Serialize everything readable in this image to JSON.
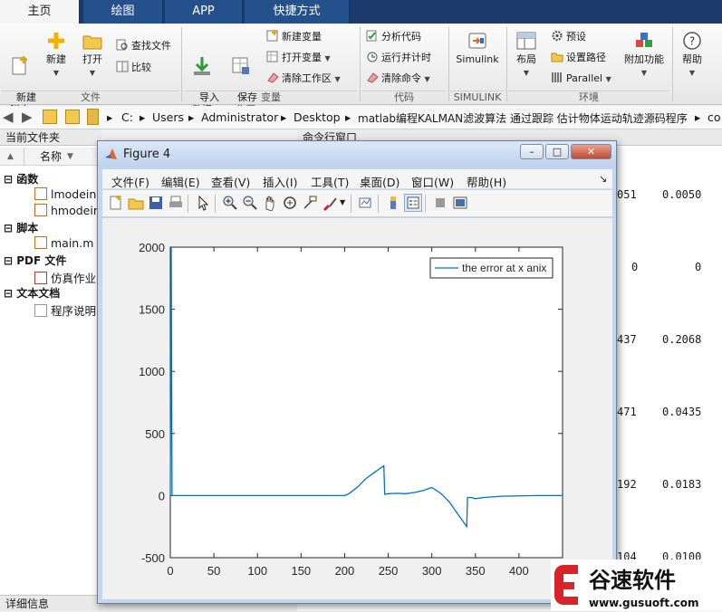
{
  "tabs": [
    "主页",
    "绘图",
    "APP",
    "快捷方式"
  ],
  "ribbon": {
    "new_script": "新建\n脚本",
    "new": "新建",
    "open": "打开",
    "find_files": "查找文件",
    "compare": "比较",
    "import_data": "导入\n数据",
    "save_workspace": "保存\n工作区",
    "new_variable": "新建变量",
    "open_variable": "打开变量",
    "clear_workspace": "清除工作区",
    "analyze_code": "分析代码",
    "run_and_time": "运行并计时",
    "clear_commands": "清除命令",
    "simulink": "Simulink",
    "layout": "布局",
    "preferences": "预设",
    "set_path": "设置路径",
    "parallel": "Parallel",
    "addons": "附加功能",
    "help": "帮助",
    "groups": {
      "file": "文件",
      "variable": "变量",
      "code": "代码",
      "simulink": "SIMULINK",
      "environment": "环境"
    }
  },
  "address": {
    "sep": "▸",
    "parts": [
      "C:",
      "Users",
      "Administrator",
      "Desktop",
      "matlab编程KALMAN滤波算法 通过跟踪 估计物体运动轨迹源码程序",
      "co"
    ]
  },
  "left_panel": {
    "title": "当前文件夹",
    "column_name": "名称",
    "sections": {
      "functions": "函数",
      "scripts": "脚本",
      "pdf": "PDF 文件",
      "text": "文本文档"
    },
    "files": {
      "func1": "lmodeini",
      "func2": "hmodeini",
      "script1": "main.m",
      "pdf1": "仿真作业",
      "text1": "程序说明"
    },
    "details": "详细信息"
  },
  "command_window": {
    "title": "命令行窗口",
    "lines": [
      {
        "a": "051",
        "b": "0.0050"
      },
      {
        "a": "0",
        "b": "0"
      },
      {
        "a": "437",
        "b": "0.2068"
      },
      {
        "a": "471",
        "b": "0.0435"
      },
      {
        "a": "192",
        "b": "0.0183"
      },
      {
        "a": "104",
        "b": "0.0100"
      }
    ]
  },
  "figure": {
    "title": "Figure 4",
    "menu": [
      "文件(F)",
      "编辑(E)",
      "查看(V)",
      "插入(I)",
      "工具(T)",
      "桌面(D)",
      "窗口(W)",
      "帮助(H)"
    ],
    "menu_arrow": "↘",
    "window_buttons": {
      "minimize": "–",
      "maximize": "□",
      "close": "✕"
    }
  },
  "chart_data": {
    "type": "line",
    "title": "",
    "xlabel": "",
    "ylabel": "",
    "xlim": [
      0,
      450
    ],
    "ylim": [
      -500,
      2000
    ],
    "xticks": [
      0,
      50,
      100,
      150,
      200,
      250,
      300,
      350,
      400
    ],
    "yticks": [
      -500,
      0,
      500,
      1000,
      1500,
      2000
    ],
    "grid": false,
    "legend_position": "top-right",
    "color": "#0072bd",
    "series": [
      {
        "name": "the error at x anix",
        "x": [
          0,
          1,
          2,
          3,
          4,
          10,
          50,
          100,
          150,
          200,
          205,
          215,
          225,
          235,
          245,
          246,
          250,
          260,
          270,
          280,
          290,
          300,
          310,
          320,
          330,
          340,
          341,
          345,
          350,
          360,
          380,
          420,
          450
        ],
        "y": [
          0,
          2000,
          0,
          0,
          0,
          0,
          0,
          0,
          0,
          0,
          15,
          70,
          140,
          190,
          240,
          10,
          15,
          18,
          15,
          25,
          40,
          65,
          20,
          -50,
          -150,
          -250,
          -15,
          -15,
          -25,
          -15,
          -5,
          0,
          0
        ]
      }
    ]
  },
  "logo": {
    "brand": "谷速软件",
    "url": "www.gusuoft.com",
    "colors": {
      "red": "#d8232a"
    }
  }
}
